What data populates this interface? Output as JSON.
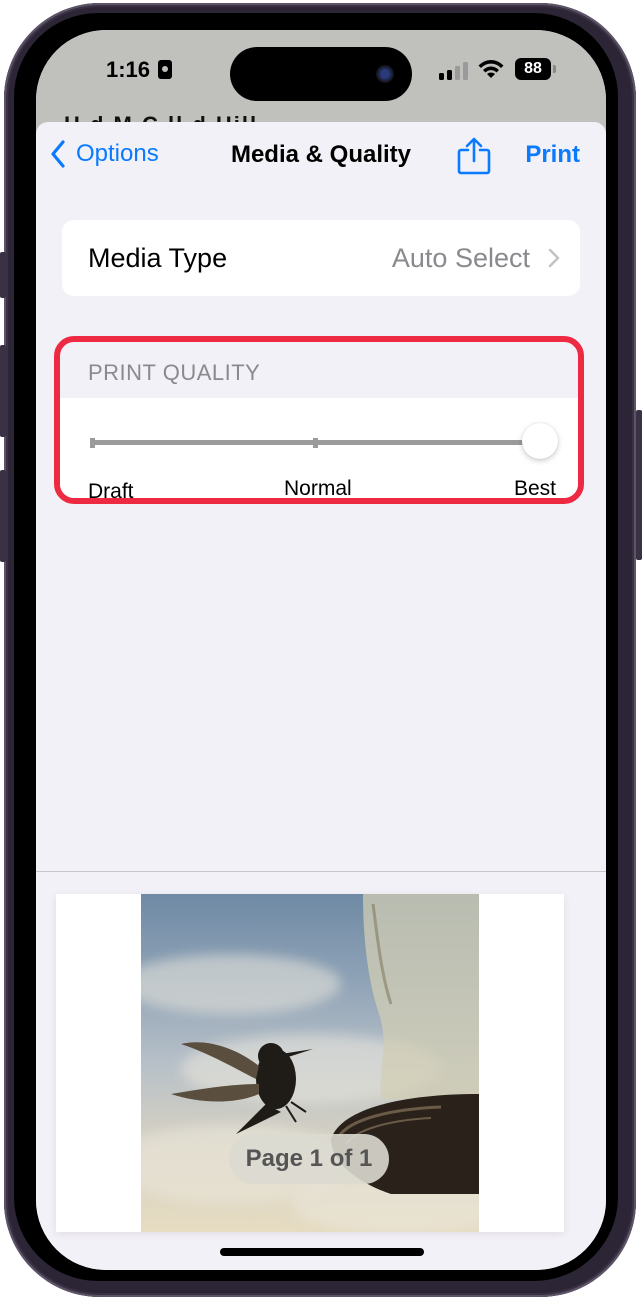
{
  "status_bar": {
    "time": "1:16",
    "battery": "88",
    "signal_bars": 2,
    "signal_total": 4,
    "icons": [
      "focus-badge-icon",
      "cellular-signal-icon",
      "wifi-icon",
      "battery-icon"
    ]
  },
  "backdrop": {
    "partial_title": "H  d     M C ll   d Hill"
  },
  "nav": {
    "back_label": "Options",
    "title": "Media & Quality",
    "share_icon": "share-icon",
    "print_label": "Print"
  },
  "media_type": {
    "label": "Media Type",
    "value": "Auto Select"
  },
  "print_quality": {
    "header": "PRINT QUALITY",
    "options": [
      "Draft",
      "Normal",
      "Best"
    ],
    "selected_index": 2,
    "highlight_color": "#ee2a43"
  },
  "preview": {
    "page_indicator": "Page 1 of 1",
    "image_subject": "hummingbird silhouette near feeder"
  },
  "colors": {
    "accent": "#0a7aff",
    "background": "#f2f1f7",
    "secondary_text": "#8a8a8e"
  }
}
